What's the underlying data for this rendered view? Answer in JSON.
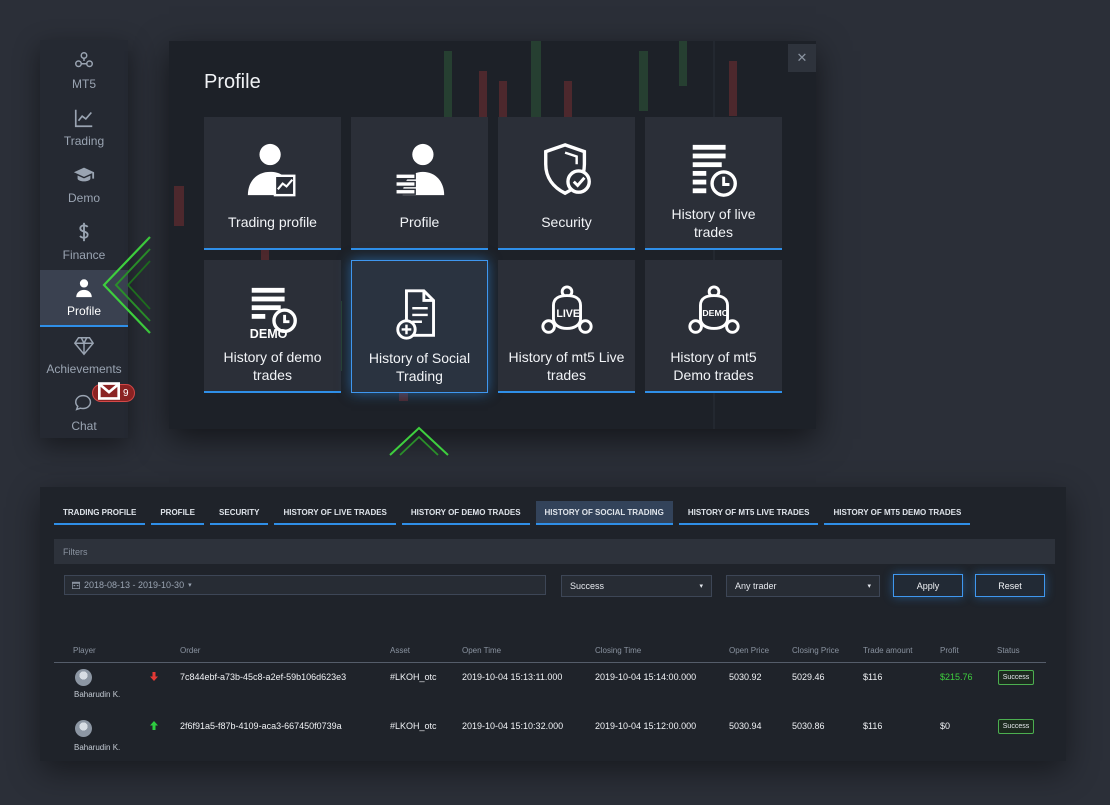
{
  "sidebar": {
    "items": [
      {
        "label": "MT5",
        "icon": "mt5-icon"
      },
      {
        "label": "Trading",
        "icon": "chart-line-icon"
      },
      {
        "label": "Demo",
        "icon": "graduation-cap-icon"
      },
      {
        "label": "Finance",
        "icon": "dollar-icon"
      },
      {
        "label": "Profile",
        "icon": "user-icon"
      },
      {
        "label": "Achievements",
        "icon": "diamond-icon"
      },
      {
        "label": "Chat",
        "icon": "chat-icon"
      }
    ],
    "active": "Profile",
    "chat_badge_count": "9"
  },
  "modal": {
    "title": "Profile",
    "close_symbol": "✕",
    "tiles": [
      {
        "label": "Trading profile",
        "icon": "trading-profile-icon"
      },
      {
        "label": "Profile",
        "icon": "profile-card-icon"
      },
      {
        "label": "Security",
        "icon": "security-shield-icon"
      },
      {
        "label": "History of live trades",
        "icon": "history-live-icon"
      },
      {
        "label": "History of demo trades",
        "icon": "history-demo-icon"
      },
      {
        "label": "History of Social Trading",
        "icon": "social-trading-doc-icon"
      },
      {
        "label": "History of mt5 Live trades",
        "icon": "mt5-live-icon"
      },
      {
        "label": "History of mt5 Demo trades",
        "icon": "mt5-demo-icon"
      }
    ],
    "selected_tile": "History of Social Trading",
    "icon_text": {
      "demo": "DEMO",
      "live": "LIVE",
      "demo_badge": "DEMO"
    }
  },
  "panel": {
    "tabs": [
      "TRADING PROFILE",
      "PROFILE",
      "SECURITY",
      "HISTORY OF LIVE TRADES",
      "HISTORY OF DEMO TRADES",
      "HISTORY OF SOCIAL TRADING",
      "HISTORY OF MT5 LIVE TRADES",
      "HISTORY OF MT5 DEMO TRADES"
    ],
    "active_tab": "HISTORY OF SOCIAL TRADING",
    "filters": {
      "label": "Filters",
      "date_range": "2018-08-13 - 2019-10-30",
      "status_value": "Success",
      "trader_value": "Any trader",
      "apply_label": "Apply",
      "reset_label": "Reset"
    },
    "table": {
      "columns": [
        "Player",
        "Order",
        "Asset",
        "Open Time",
        "Closing Time",
        "Open Price",
        "Closing Price",
        "Trade amount",
        "Profit",
        "Status"
      ],
      "rows": [
        {
          "player": "Baharudin K.",
          "direction": "down",
          "order": "7c844ebf-a73b-45c8-a2ef-59b106d623e3",
          "asset": "#LKOH_otc",
          "open_time": "2019-10-04 15:13:11.000",
          "closing_time": "2019-10-04 15:14:00.000",
          "open_price": "5030.92",
          "closing_price": "5029.46",
          "trade_amount": "$116",
          "profit": "$215.76",
          "status": "Success"
        },
        {
          "player": "Baharudin K.",
          "direction": "up",
          "order": "2f6f91a5-f87b-4109-aca3-667450f0739a",
          "asset": "#LKOH_otc",
          "open_time": "2019-10-04 15:10:32.000",
          "closing_time": "2019-10-04 15:12:00.000",
          "open_price": "5030.94",
          "closing_price": "5030.86",
          "trade_amount": "$116",
          "profit": "$0",
          "status": "Success"
        }
      ]
    }
  },
  "colors": {
    "accent": "#2f8fe8",
    "green_arrow": "#3ecf3e",
    "profit_positive": "#3ecf3e",
    "down_arrow": "#e53935",
    "up_arrow": "#2ecc40"
  }
}
